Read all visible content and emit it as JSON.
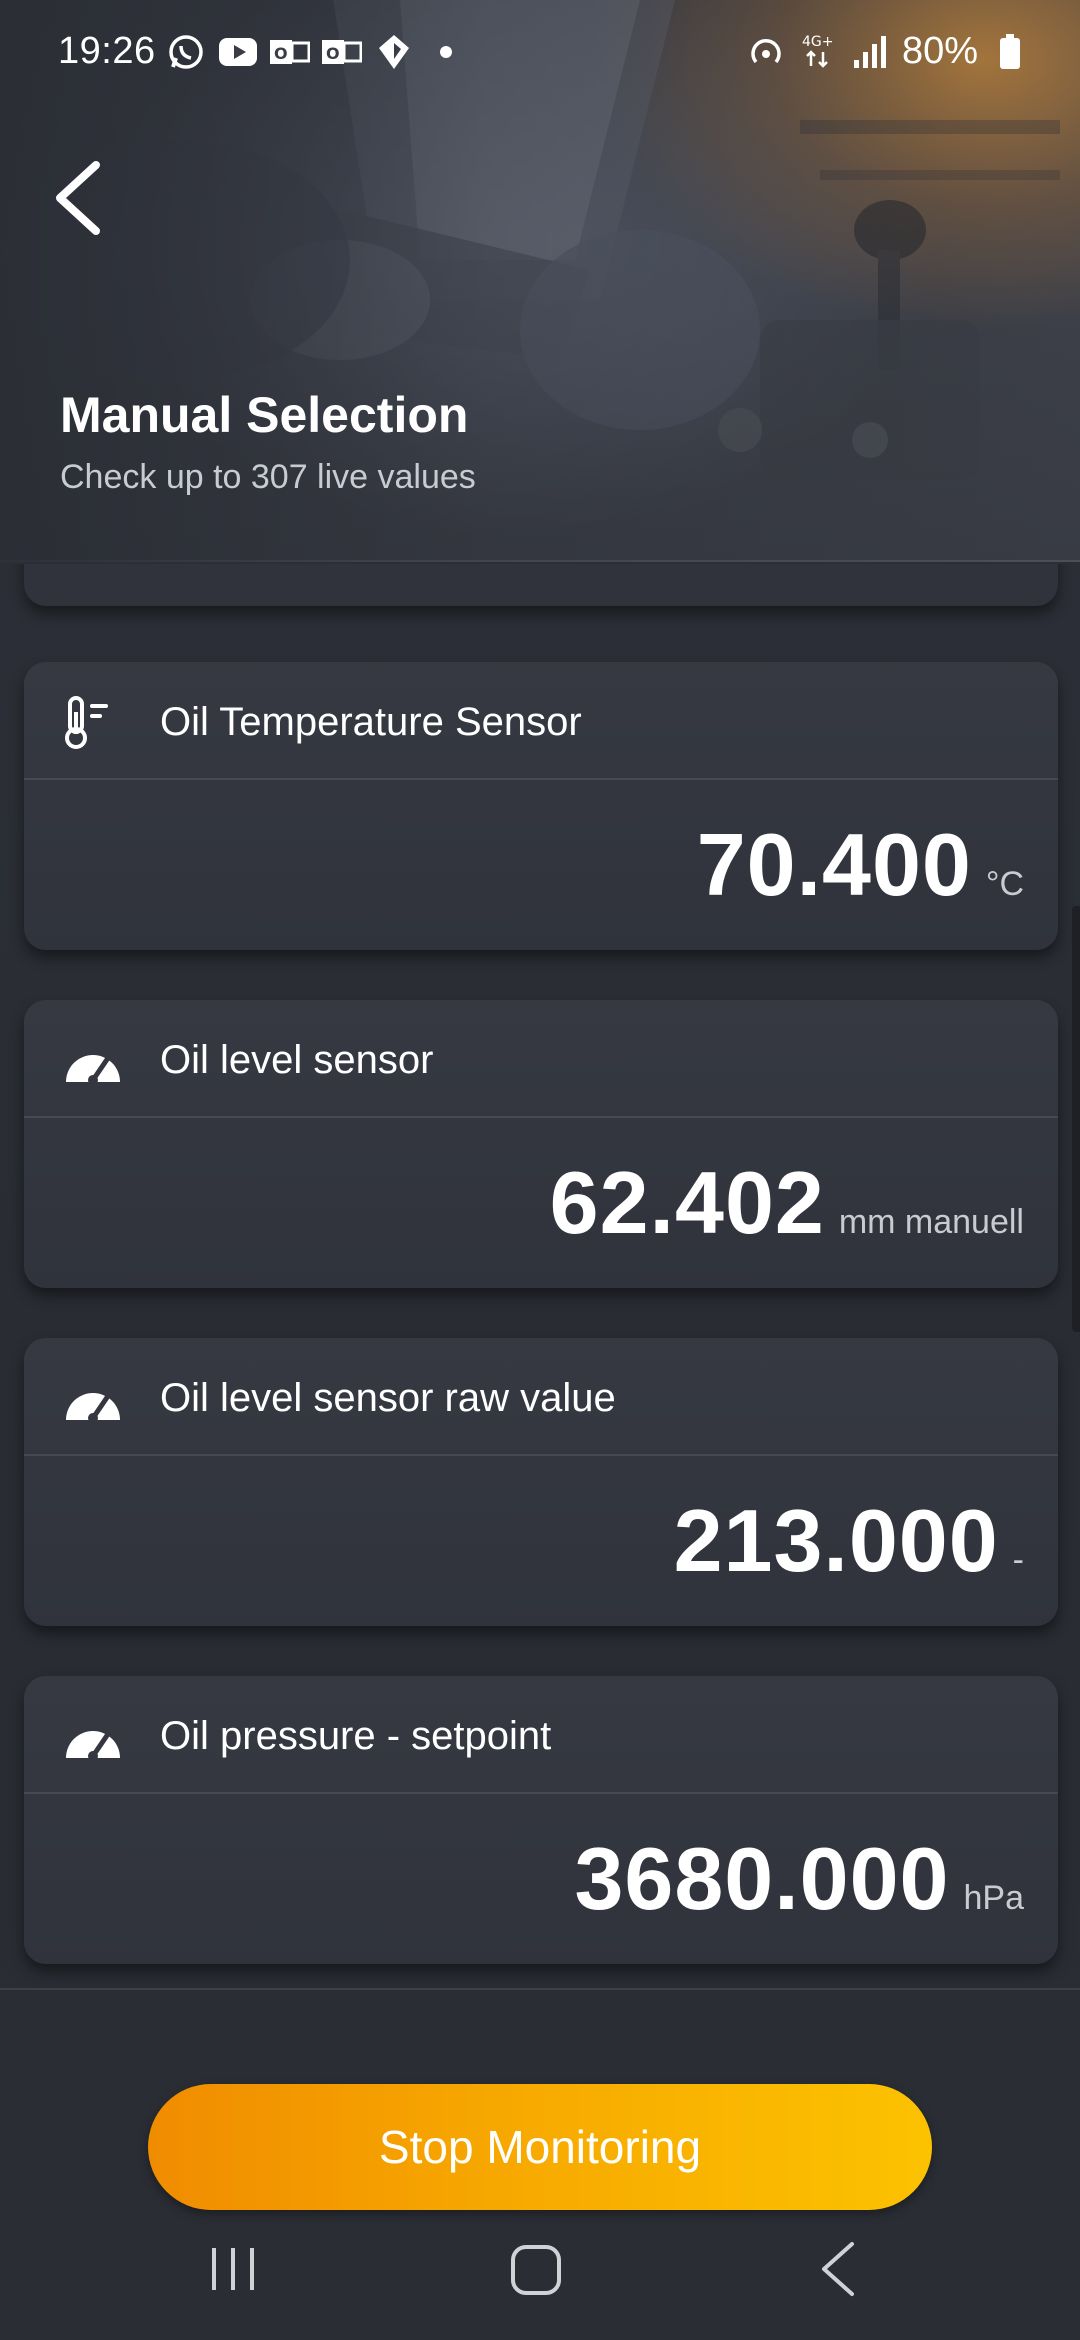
{
  "status_bar": {
    "time": "19:26",
    "battery": "80%",
    "network": "4G+",
    "left_icons": [
      "whatsapp-icon",
      "youtube-icon",
      "outlook-icon",
      "outlook-icon",
      "diamond-icon",
      "dot-icon"
    ],
    "right_icons": [
      "hotspot-icon",
      "data-arrows-icon",
      "signal-icon",
      "battery-icon"
    ]
  },
  "header": {
    "title": "Manual Selection",
    "subtitle": "Check up to 307 live values"
  },
  "cards": [
    {
      "icon": "thermometer-icon",
      "label": "Oil Temperature Sensor",
      "value": "70.400",
      "unit": "°C"
    },
    {
      "icon": "gauge-icon",
      "label": "Oil level sensor",
      "value": "62.402",
      "unit": "mm manuell"
    },
    {
      "icon": "gauge-icon",
      "label": "Oil level sensor raw value",
      "value": "213.000",
      "unit": "-"
    },
    {
      "icon": "gauge-icon",
      "label": "Oil pressure - setpoint",
      "value": "3680.000",
      "unit": "hPa"
    }
  ],
  "actions": {
    "stop_label": "Stop Monitoring"
  },
  "colors": {
    "accent_start": "#f08c00",
    "accent_end": "#fcc200",
    "card_bg": "#34373f",
    "page_bg": "#2a2d35"
  },
  "nav": [
    "recents-icon",
    "home-icon",
    "back-icon"
  ]
}
